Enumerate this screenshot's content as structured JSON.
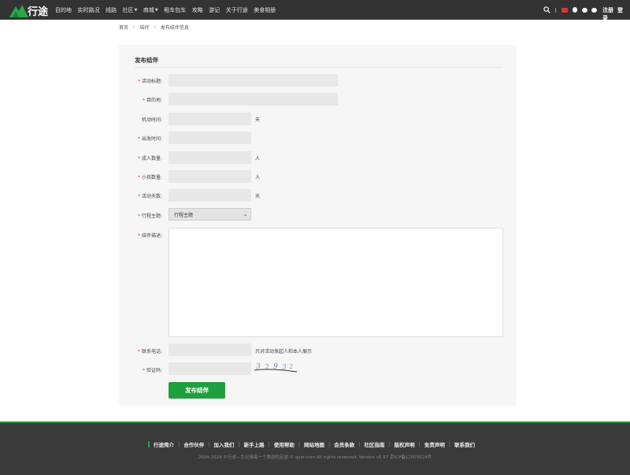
{
  "brand": {
    "name": "行途",
    "accent": "#1ea03f"
  },
  "nav": {
    "items": [
      {
        "label": "目的地",
        "dropdown": false
      },
      {
        "label": "实时路况",
        "dropdown": false
      },
      {
        "label": "线路",
        "dropdown": false
      },
      {
        "label": "社区",
        "dropdown": true
      },
      {
        "label": "商城",
        "dropdown": true
      },
      {
        "label": "租车包车",
        "dropdown": false
      },
      {
        "label": "攻略",
        "dropdown": false
      },
      {
        "label": "游记",
        "dropdown": false
      },
      {
        "label": "关于行途",
        "dropdown": false
      },
      {
        "label": "美食相册",
        "dropdown": false
      }
    ],
    "register": "注册",
    "login": "登录"
  },
  "breadcrumb": {
    "home": "首页",
    "section": "结伴",
    "current": "发布结伴信息"
  },
  "form": {
    "title": "发布结伴",
    "fields": {
      "activity_title": {
        "label": "活动标题:",
        "required": true
      },
      "destination": {
        "label": "目的地:",
        "required": true
      },
      "flex_time": {
        "label": "机动时间:",
        "required": false,
        "unit": "天"
      },
      "departure_time": {
        "label": "出发时间:",
        "required": true
      },
      "adults": {
        "label": "成人数量:",
        "required": true,
        "unit": "人"
      },
      "children": {
        "label": "小孩数量:",
        "required": true,
        "unit": "人"
      },
      "days": {
        "label": "活动天数:",
        "required": true,
        "unit": "天"
      },
      "theme": {
        "label": "行程主题:",
        "required": true,
        "selected": "行程主题"
      },
      "description": {
        "label": "结伴描述:",
        "required": true
      },
      "phone": {
        "label": "联系电话:",
        "required": true,
        "note": "只对活动发起人和本人展示"
      },
      "captcha": {
        "label": "验证码:",
        "required": true
      }
    },
    "submit_label": "发布结伴"
  },
  "footer": {
    "links": [
      "行途简介",
      "合作伙伴",
      "加入我们",
      "新手上路",
      "使用帮助",
      "网站地图",
      "会员条款",
      "社区指南",
      "版权声明",
      "免责声明",
      "联系我们"
    ],
    "copyright": "2004-2024 ©行途—为记录每一个旅途的足迹 © qyer.com All rights reserved. Version v5.57 京ICP备12003524号"
  }
}
